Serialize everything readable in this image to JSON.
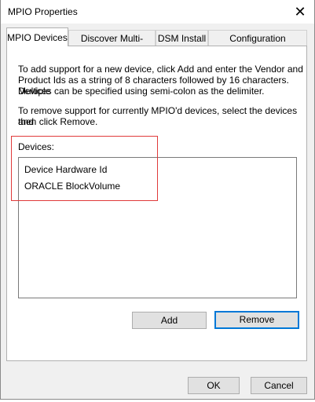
{
  "window": {
    "title": "MPIO Properties",
    "close_symbol": "✕"
  },
  "tabs": [
    {
      "label": "MPIO Devices",
      "active": true
    },
    {
      "label": "Discover Multi-Paths",
      "active": false
    },
    {
      "label": "DSM Install",
      "active": false
    },
    {
      "label": "Configuration Snapshot",
      "active": false
    }
  ],
  "mpio_devices": {
    "instructions_add": [
      "To add support for a new device, click Add and enter the Vendor and",
      "Product Ids as a string of 8 characters followed by 16 characters. Multiple",
      "Devices can be specified using semi-colon as the delimiter."
    ],
    "instructions_remove": [
      "To remove support for currently MPIO'd devices, select the devices and",
      "then click Remove."
    ],
    "devices_label": "Devices:",
    "devices": [
      "Device Hardware Id",
      "ORACLE  BlockVolume"
    ],
    "add_label": "Add",
    "remove_label": "Remove"
  },
  "footer": {
    "ok_label": "OK",
    "cancel_label": "Cancel"
  },
  "colors": {
    "highlight_box": "#e03a3a",
    "default_button_border": "#0078d7"
  }
}
